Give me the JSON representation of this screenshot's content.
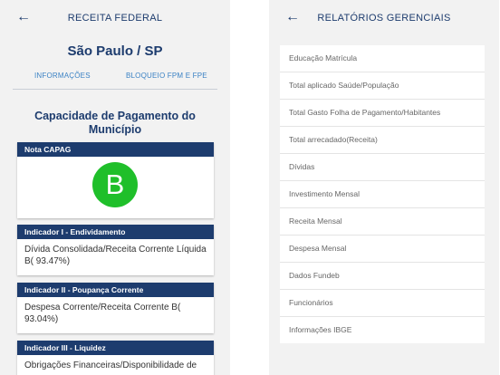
{
  "left_screen": {
    "header_title": "RECEITA FEDERAL",
    "city": "São Paulo / SP",
    "tabs": [
      "INFORMAÇÕES",
      "BLOQUEIO FPM E FPE"
    ],
    "section_title": "Capacidade de Pagamento do Município",
    "capag": {
      "header": "Nota CAPAG",
      "grade": "B",
      "grade_color": "#1fbf2a"
    },
    "indicators": [
      {
        "header": "Indicador I - Endividamento",
        "text": "Dívida Consolidada/Receita Corrente Líquida B( 93.47%)"
      },
      {
        "header": "Indicador II - Poupança Corrente",
        "text": "Despesa Corrente/Receita Corrente B( 93.04%)"
      },
      {
        "header": "Indicador III - Liquidez",
        "text": "Obrigações Financeiras/Disponibilidade de"
      }
    ]
  },
  "right_screen": {
    "header_title": "RELATÓRIOS GERENCIAIS",
    "items": [
      "Educação Matrícula",
      "Total aplicado Saúde/População",
      "Total Gasto Folha de Pagamento/Habitantes",
      "Total arrecadado(Receita)",
      "Dívidas",
      "Investimento Mensal",
      "Receita Mensal",
      "Despesa Mensal",
      "Dados Fundeb",
      "Funcionários",
      "Informações IBGE"
    ]
  },
  "icons": {
    "back": "arrow-left-icon"
  },
  "colors": {
    "primary": "#1d3c6e",
    "tab_link": "#3b82c4",
    "background": "#f2f2f2"
  }
}
